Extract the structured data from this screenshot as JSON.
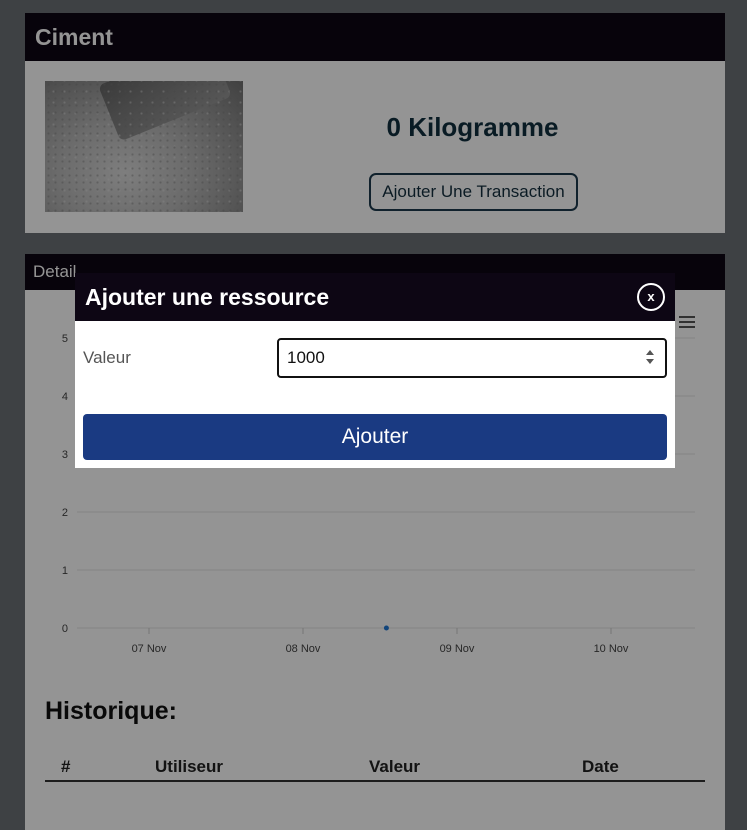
{
  "product": {
    "title": "Ciment",
    "quantity": "0 Kilogramme",
    "add_transaction_label": "Ajouter Une Transaction"
  },
  "details": {
    "title": "Detail"
  },
  "chart_data": {
    "type": "scatter",
    "title": "",
    "xlabel": "",
    "ylabel": "",
    "x_ticks": [
      "07 Nov",
      "08 Nov",
      "09 Nov",
      "10 Nov"
    ],
    "y_ticks": [
      "0",
      "1",
      "2",
      "3",
      "4",
      "5"
    ],
    "ylim": [
      0,
      5
    ],
    "points": [
      {
        "x": "08 Nov 13:00",
        "y": 0
      }
    ],
    "grid": true,
    "color": "#1f77d4"
  },
  "history": {
    "title": "Historique:",
    "columns": [
      "#",
      "Utiliseur",
      "Valeur",
      "Date"
    ],
    "rows": []
  },
  "modal": {
    "title": "Ajouter une ressource",
    "close_label": "x",
    "field_label": "Valeur",
    "field_value": "1000",
    "submit_label": "Ajouter"
  },
  "colors": {
    "header_bg": "#0d0614",
    "primary_button": "#1a3a82",
    "quantity_text": "#10303e"
  }
}
